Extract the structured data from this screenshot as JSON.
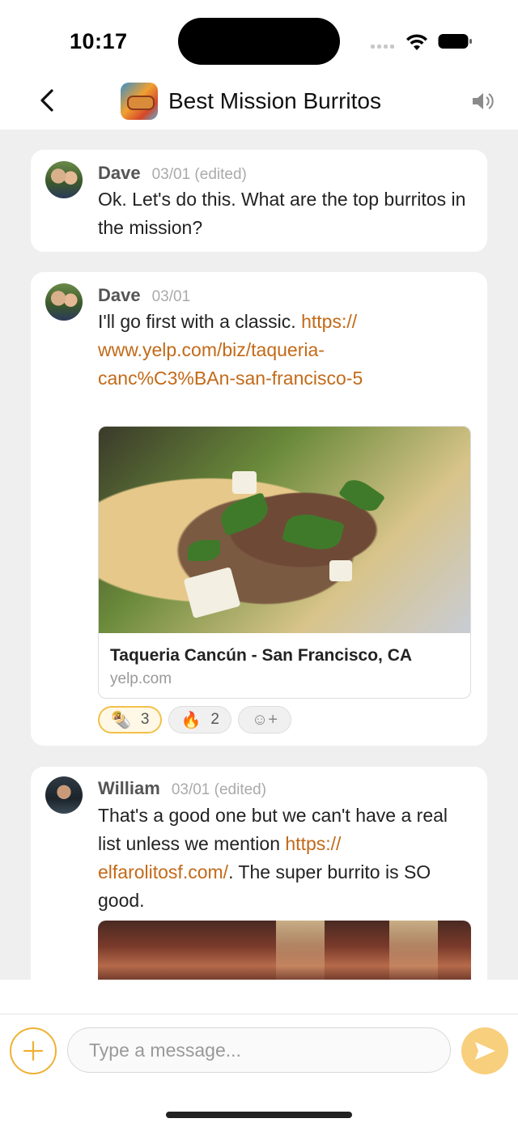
{
  "status_bar": {
    "time": "10:17"
  },
  "header": {
    "title": "Best Mission Burritos"
  },
  "messages": [
    {
      "author": "Dave",
      "meta": "03/01 (edited)",
      "text": "Ok. Let's do this. What are the top burritos in the mission?"
    },
    {
      "author": "Dave",
      "meta": "03/01",
      "text_prefix": "I'll go first with a classic. ",
      "link_text": "https://www.yelp.com/biz/taqueria-canc%C3%BAn-san-francisco-5",
      "link_line1": "https://",
      "link_line2": "www.yelp.com/biz/taqueria-",
      "link_line3": "canc%C3%BAn-san-francisco-5",
      "preview": {
        "title": "Taqueria Cancún - San Francisco, CA",
        "domain": "yelp.com"
      },
      "reactions": [
        {
          "emoji": "🌯",
          "count": "3",
          "selected": true
        },
        {
          "emoji": "🔥",
          "count": "2",
          "selected": false
        }
      ],
      "add_reaction": "☺+"
    },
    {
      "author": "William",
      "meta": "03/01 (edited)",
      "line1": "That's a good one but we can't have a real",
      "line2_prefix": "list unless we mention ",
      "link_a": "https://",
      "link_b": "elfarolitosf.com/",
      "line3_suffix": ". The super burrito is SO",
      "line4": "good."
    }
  ],
  "input": {
    "placeholder": "Type a message..."
  },
  "colors": {
    "accent": "#efb132",
    "link": "#c26a18",
    "send": "#f8cf7c"
  }
}
